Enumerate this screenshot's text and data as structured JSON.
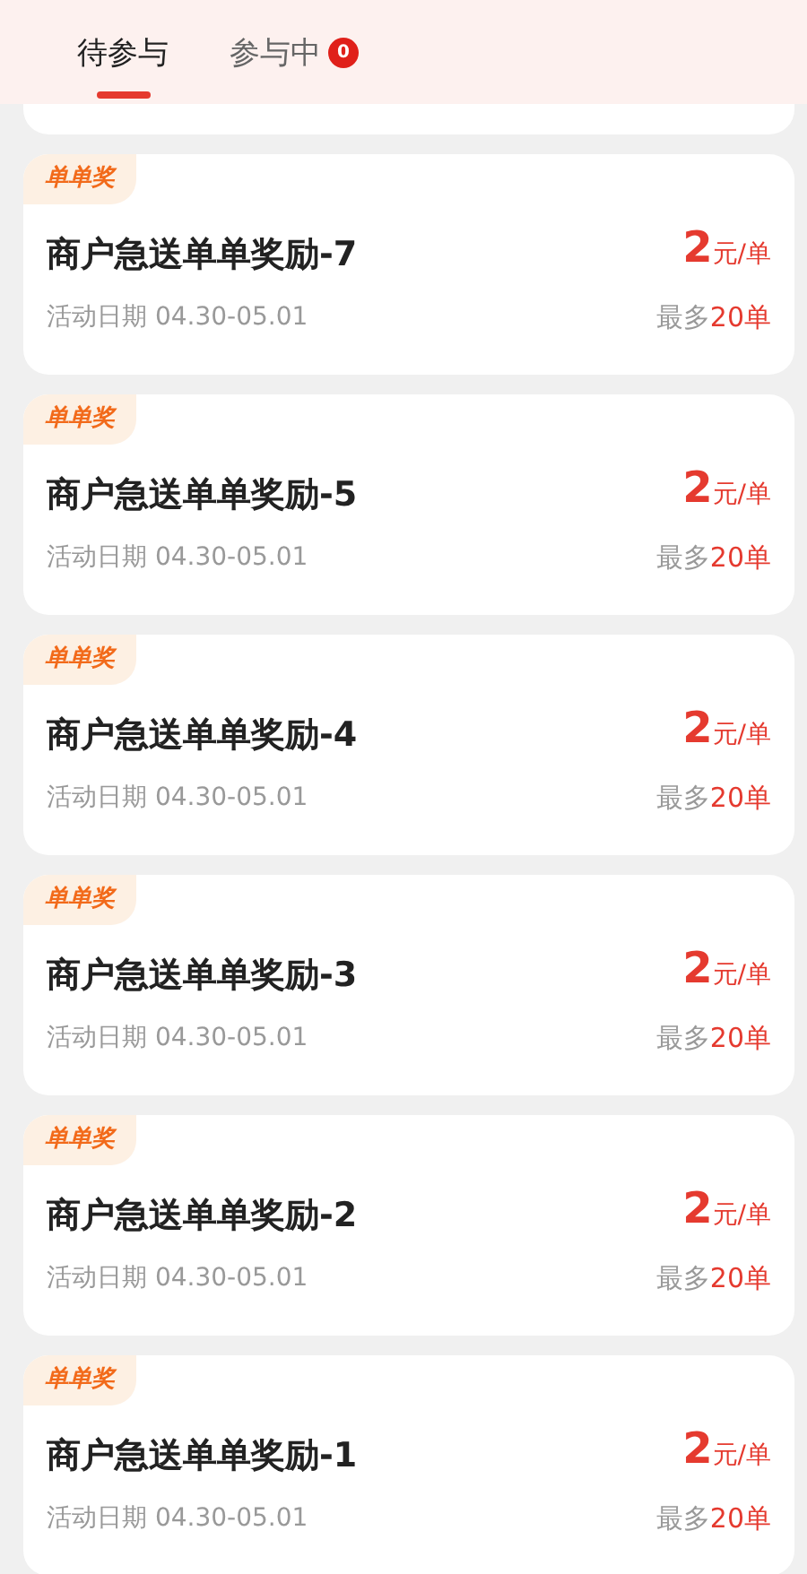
{
  "tabs": [
    {
      "label": "待参与",
      "selected": true
    },
    {
      "label": "参与中",
      "selected": false,
      "badge": "0"
    }
  ],
  "activities": [
    {
      "tag": "单单奖",
      "title": "商户急送单单奖励-7",
      "date": "活动日期 04.30-05.01",
      "amount": "2",
      "unit": "元/单",
      "limit_prefix": "最多",
      "limit": "20单"
    },
    {
      "tag": "单单奖",
      "title": "商户急送单单奖励-5",
      "date": "活动日期 04.30-05.01",
      "amount": "2",
      "unit": "元/单",
      "limit_prefix": "最多",
      "limit": "20单"
    },
    {
      "tag": "单单奖",
      "title": "商户急送单单奖励-4",
      "date": "活动日期 04.30-05.01",
      "amount": "2",
      "unit": "元/单",
      "limit_prefix": "最多",
      "limit": "20单"
    },
    {
      "tag": "单单奖",
      "title": "商户急送单单奖励-3",
      "date": "活动日期 04.30-05.01",
      "amount": "2",
      "unit": "元/单",
      "limit_prefix": "最多",
      "limit": "20单"
    },
    {
      "tag": "单单奖",
      "title": "商户急送单单奖励-2",
      "date": "活动日期 04.30-05.01",
      "amount": "2",
      "unit": "元/单",
      "limit_prefix": "最多",
      "limit": "20单"
    },
    {
      "tag": "单单奖",
      "title": "商户急送单单奖励-1",
      "date": "活动日期 04.30-05.01",
      "amount": "2",
      "unit": "元/单",
      "limit_prefix": "最多",
      "limit": "20单"
    }
  ]
}
